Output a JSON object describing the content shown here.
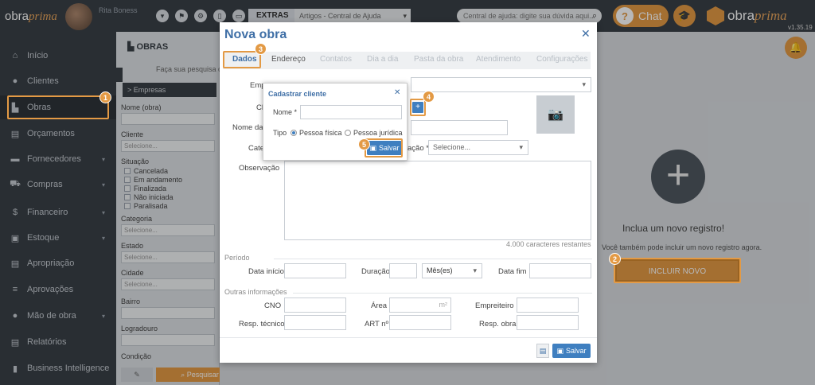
{
  "topbar": {
    "logo_main": "obra",
    "logo_script": "prima",
    "user_name": "Rita Boness",
    "extras_label": "EXTRAS",
    "help_select": "Artigos - Central de Ajuda",
    "search_placeholder": "Central de ajuda: digite sua dúvida aqui...",
    "chat_label": "Chat",
    "brand_main": "obra",
    "brand_script": "prima",
    "version": "v1.35.19"
  },
  "sidebar": {
    "items": [
      {
        "label": "Início"
      },
      {
        "label": "Clientes"
      },
      {
        "label": "Obras"
      },
      {
        "label": "Orçamentos"
      },
      {
        "label": "Fornecedores"
      },
      {
        "label": "Compras"
      },
      {
        "label": "Financeiro"
      },
      {
        "label": "Estoque"
      },
      {
        "label": "Apropriação"
      },
      {
        "label": "Aprovações"
      },
      {
        "label": "Mão de obra"
      },
      {
        "label": "Relatórios"
      },
      {
        "label": "Business Intelligence"
      }
    ]
  },
  "filters": {
    "title": "OBRAS",
    "hint": "Faça sua pesquisa de",
    "empresas": "> Empresas",
    "nome_label": "Nome (obra)",
    "cliente_label": "Cliente",
    "cliente_ph": "Selecione...",
    "situacao_label": "Situação",
    "situacoes": [
      "Cancelada",
      "Em andamento",
      "Finalizada",
      "Não iniciada",
      "Paralisada"
    ],
    "categoria_label": "Categoria",
    "categoria_ph": "Selecione...",
    "estado_label": "Estado",
    "estado_ph": "Selecione...",
    "cidade_label": "Cidade",
    "cidade_ph": "Selecione...",
    "bairro_label": "Bairro",
    "logradouro_label": "Logradouro",
    "condicao_label": "Condição",
    "pesquisar": "Pesquisar"
  },
  "empty": {
    "title": "Inclua um novo registro!",
    "subtitle": "Você também pode incluir um novo registro agora.",
    "button": "INCLUIR NOVO"
  },
  "modal": {
    "title": "Nova obra",
    "tabs": [
      "Dados",
      "Endereço",
      "Contatos",
      "Dia a dia",
      "Pasta da obra",
      "Atendimento",
      "Configurações"
    ],
    "empresa_label": "Empr",
    "cliente_label": "Cl",
    "nome_obra_label": "Nome da",
    "categoria_label": "Cate",
    "situacao_label": "ação *",
    "situacao_ph": "Selecione...",
    "observacao_label": "Observação",
    "chars": "4.000  caracteres restantes",
    "periodo": "Período",
    "data_inicio": "Data início",
    "duracao": "Duração",
    "meses": "Mês(es)",
    "data_fim": "Data fim",
    "outras": "Outras informações",
    "cno": "CNO",
    "area": "Área",
    "area_unit": "m²",
    "empreiteiro": "Empreiteiro",
    "resp_tecnico": "Resp. técnico",
    "art": "ART nº",
    "resp_obra": "Resp. obra",
    "save": "Salvar"
  },
  "popup": {
    "title": "Cadastrar cliente",
    "nome_label": "Nome *",
    "tipo_label": "Tipo",
    "fisica": "Pessoa física",
    "juridica": "Pessoa jurídica",
    "save": "Salvar"
  },
  "badges": [
    "1",
    "2",
    "3",
    "4",
    "5"
  ],
  "colors": {
    "accent": "#e39a45",
    "primary": "#3f7fc0",
    "dark": "#3a4047"
  }
}
